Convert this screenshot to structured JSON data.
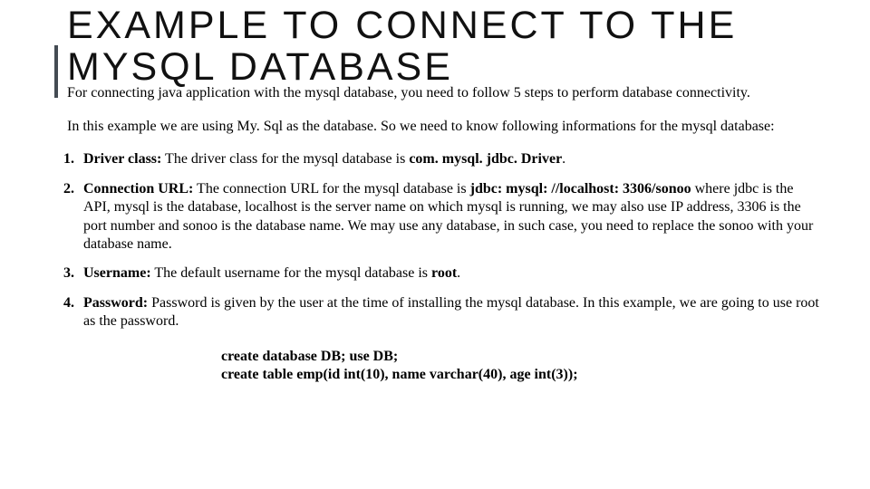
{
  "title": "EXAMPLE TO CONNECT TO THE MYSQL DATABASE",
  "intro1": "For connecting java application with the mysql database, you need to follow 5 steps to perform database connectivity.",
  "intro2": "In this example we are using My. Sql as the database. So we need to know following informations for the mysql database:",
  "items": [
    {
      "num": "1.",
      "label": "Driver class:",
      "text_a": " The driver class for the mysql database is ",
      "bold_a": "com. mysql. jdbc. Driver",
      "text_b": ".",
      "bold_b": "",
      "text_c": ""
    },
    {
      "num": "2.",
      "label": "Connection URL:",
      "text_a": " The connection URL for the mysql database is ",
      "bold_a": "jdbc: mysql: //localhost: 3306/sonoo",
      "text_b": " where jdbc is the API, mysql is the database, localhost is the server name on which mysql is running, we may also use IP address, 3306 is the port number and sonoo is the database name. We may use any database, in such case, you need to replace the sonoo with your database name.",
      "bold_b": "",
      "text_c": ""
    },
    {
      "num": "3.",
      "label": "Username:",
      "text_a": " The default username for the mysql database is ",
      "bold_a": "root",
      "text_b": ".",
      "bold_b": "",
      "text_c": ""
    },
    {
      "num": "4.",
      "label": "Password:",
      "text_a": " Password is given by the user at the time of installing the mysql database. In this example, we are going to use root as the password.",
      "bold_a": "",
      "text_b": "",
      "bold_b": "",
      "text_c": ""
    }
  ],
  "code": "create database DB;  use DB;\ncreate table emp(id int(10), name varchar(40), age int(3));"
}
